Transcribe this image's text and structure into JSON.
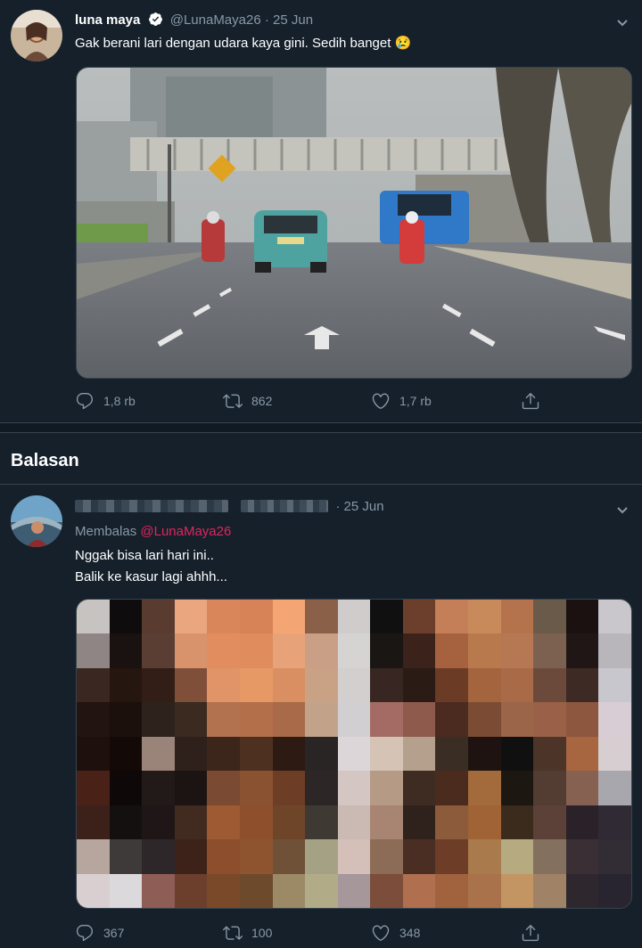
{
  "tweet": {
    "display_name": "luna maya",
    "handle": "@LunaMaya26",
    "date": "· 25 Jun",
    "text": "Gak berani lari dengan udara kaya gini. Sedih banget 😢",
    "actions": {
      "reply_count": "1,8 rb",
      "retweet_count": "862",
      "like_count": "1,7 rb"
    }
  },
  "replies_heading": "Balasan",
  "reply": {
    "date": "· 25 Jun",
    "replying_to_label": "Membalas",
    "replying_to_handle": "@LunaMaya26",
    "text_line1": "Nggak bisa lari hari ini..",
    "text_line2": "Balik ke kasur lagi ahhh...",
    "actions": {
      "reply_count": "367",
      "retweet_count": "100",
      "like_count": "348"
    }
  },
  "colors": {
    "background": "#15202b",
    "muted": "#8899a6",
    "mention": "#e0245e",
    "verified": "#ffffff"
  },
  "icons": [
    "reply-icon",
    "retweet-icon",
    "like-icon",
    "share-icon",
    "verified-icon",
    "chevron-down-icon"
  ]
}
